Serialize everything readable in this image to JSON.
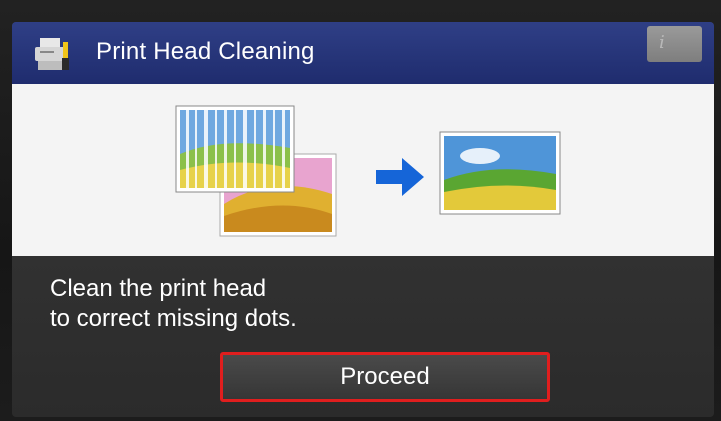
{
  "header": {
    "title": "Print Head Cleaning",
    "title_icon": "printer-maintenance-icon",
    "info_icon": "info-icon",
    "info_glyph": "i"
  },
  "illustration": {
    "before_icon": "striped-print-image",
    "arrow_icon": "arrow-right-icon",
    "after_icon": "clean-print-image"
  },
  "message": {
    "line1": "Clean the print head",
    "line2": "to correct missing dots."
  },
  "actions": {
    "proceed_label": "Proceed"
  },
  "colors": {
    "title_bar": "#24337a",
    "highlight_border": "#e01e1e",
    "arrow": "#1565d8"
  }
}
